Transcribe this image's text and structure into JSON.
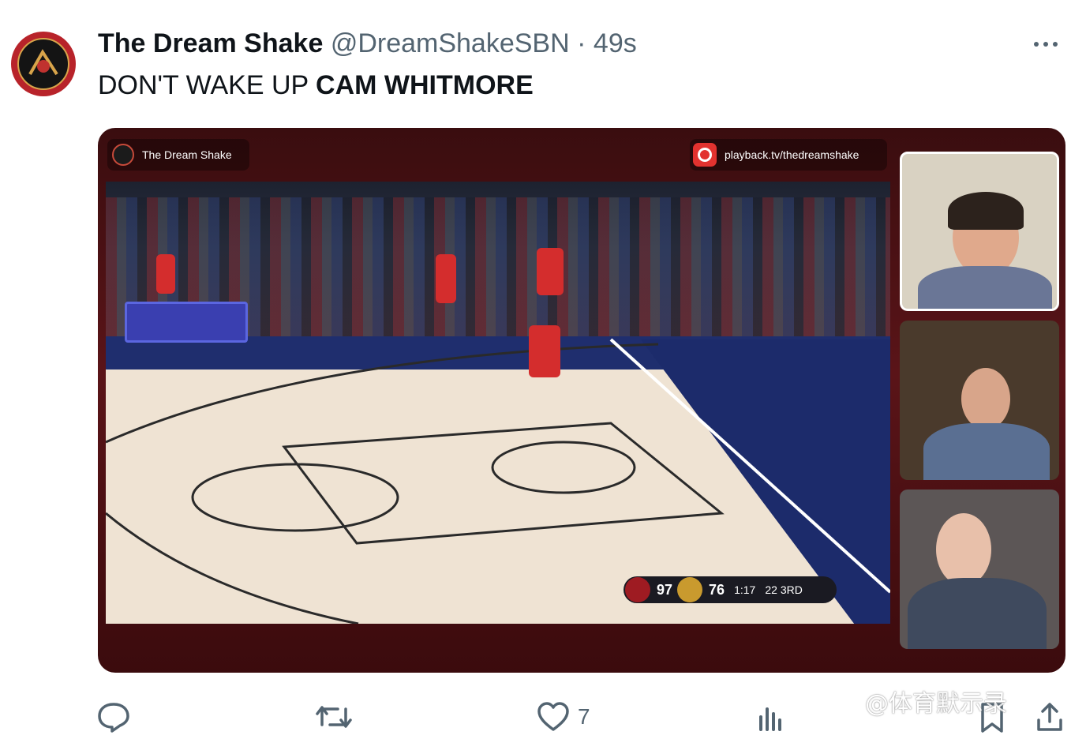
{
  "tweet": {
    "display_name": "The Dream Shake",
    "handle": "@DreamShakeSBN",
    "separator": "·",
    "time": "49s",
    "text_plain": "DON'T WAKE UP ",
    "text_bold": "CAM WHITMORE"
  },
  "media": {
    "brand_label": "The Dream Shake",
    "playback_url": "playback.tv/thedreamshake",
    "scoreboard": {
      "home_score": "97",
      "away_score": "76",
      "clock": "1:17",
      "shot_clock": "22",
      "period": "3RD"
    }
  },
  "actions": {
    "like_count": "7"
  },
  "icons": [
    "more-icon",
    "reply-icon",
    "retweet-icon",
    "like-icon",
    "views-icon",
    "bookmark-icon",
    "share-icon"
  ],
  "watermark": "@体育默示录",
  "colors": {
    "text": "#0f1419",
    "secondary": "#536471",
    "media_frame": "#4a1114"
  }
}
